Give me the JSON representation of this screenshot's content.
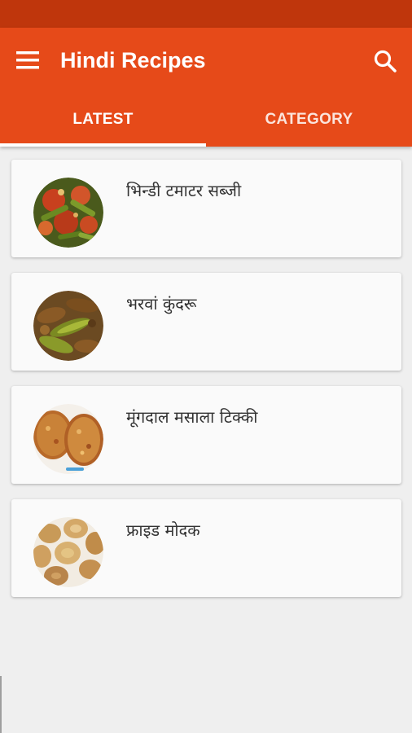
{
  "app": {
    "title": "Hindi Recipes"
  },
  "header": {
    "menu_icon": "hamburger-menu-icon",
    "search_icon": "search-icon"
  },
  "tabs": [
    {
      "label": "LATEST",
      "active": true
    },
    {
      "label": "CATEGORY",
      "active": false
    }
  ],
  "recipes": [
    {
      "title": "भिन्डी टमाटर सब्जी",
      "image": "bhindi-tomato-photo"
    },
    {
      "title": "भरवां कुंदरू",
      "image": "stuffed-kundru-photo"
    },
    {
      "title": "मूंगदाल मसाला टिक्की",
      "image": "moong-dal-tikki-photo"
    },
    {
      "title": "फ्राइड मोदक",
      "image": "fried-modak-photo"
    }
  ],
  "colors": {
    "status_bar": "#bf360c",
    "primary": "#e64a19",
    "background": "#efefef",
    "card": "#fafafa",
    "text": "#333333"
  }
}
